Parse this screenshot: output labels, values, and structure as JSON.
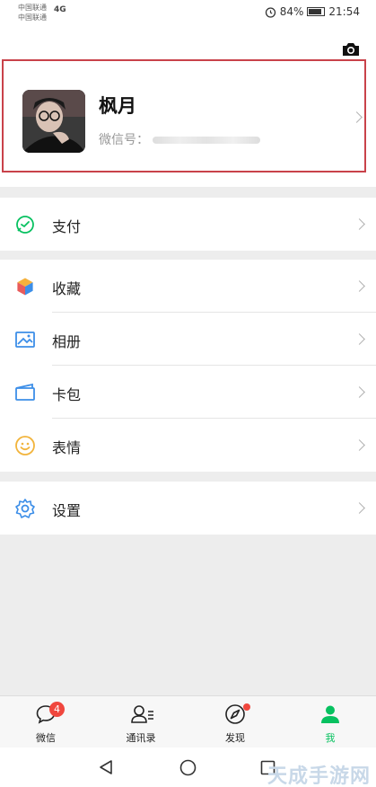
{
  "status_bar": {
    "carrier1": "中国联通",
    "carrier2": "中国联通",
    "signal": "4G",
    "battery": "84%",
    "time": "21:54"
  },
  "profile": {
    "nickname": "枫月",
    "wechat_id_label": "微信号："
  },
  "menu": {
    "pay": "支付",
    "favorites": "收藏",
    "album": "相册",
    "cards": "卡包",
    "stickers": "表情",
    "settings": "设置"
  },
  "tabbar": {
    "chats": "微信",
    "chats_badge": "4",
    "contacts": "通讯录",
    "discover": "发现",
    "me": "我"
  },
  "watermark": "天成手游网",
  "colors": {
    "accent": "#07c160",
    "badge": "#f0473e",
    "highlight_border": "#c9424a"
  }
}
